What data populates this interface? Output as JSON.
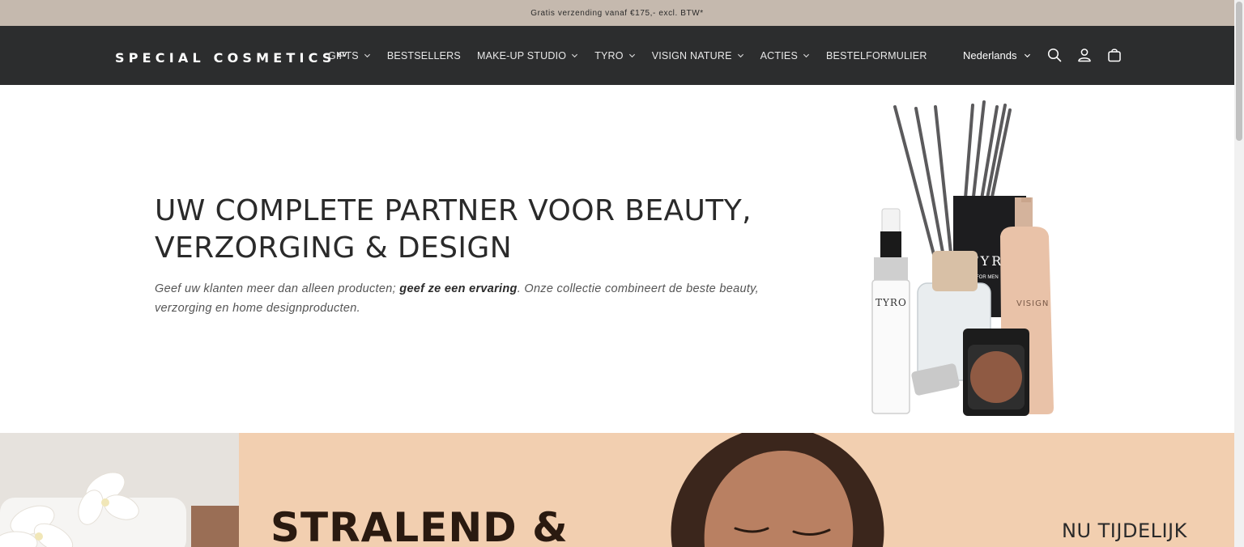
{
  "announcement": {
    "text": "Gratis verzending vanaf €175,- excl. BTW*"
  },
  "header": {
    "logo_text": "SPECIAL COSMETICS",
    "logo_suffix": "BV",
    "nav": [
      {
        "label": "GIFTS",
        "has_dropdown": true
      },
      {
        "label": "BESTSELLERS",
        "has_dropdown": false
      },
      {
        "label": "MAKE-UP STUDIO",
        "has_dropdown": true
      },
      {
        "label": "TYRO",
        "has_dropdown": true
      },
      {
        "label": "VISIGN NATURE",
        "has_dropdown": true
      },
      {
        "label": "ACTIES",
        "has_dropdown": true
      },
      {
        "label": "BESTELFORMULIER",
        "has_dropdown": false
      }
    ],
    "language": "Nederlands",
    "icons": [
      "search-icon",
      "account-icon",
      "cart-icon"
    ]
  },
  "hero": {
    "title_line1": "UW COMPLETE PARTNER VOOR BEAUTY,",
    "title_line2": "VERZORGING & DESIGN",
    "text_before": "Geef uw klanten meer dan alleen producten; ",
    "text_bold": "geef ze een ervaring",
    "text_after": ". Onze collectie combineert de beste beauty, verzorging en home designproducten.",
    "product_labels": {
      "tyro": "TYRO",
      "tyro_box": "TYRO",
      "visign": "VISIGN"
    }
  },
  "promo": {
    "title": "STRALEND &",
    "side_text": "NU TIJDELIJK"
  },
  "colors": {
    "announcement_bg": "#c5b9ae",
    "header_bg": "#2c2d2e",
    "promo_bg": "#f2cfb0"
  }
}
